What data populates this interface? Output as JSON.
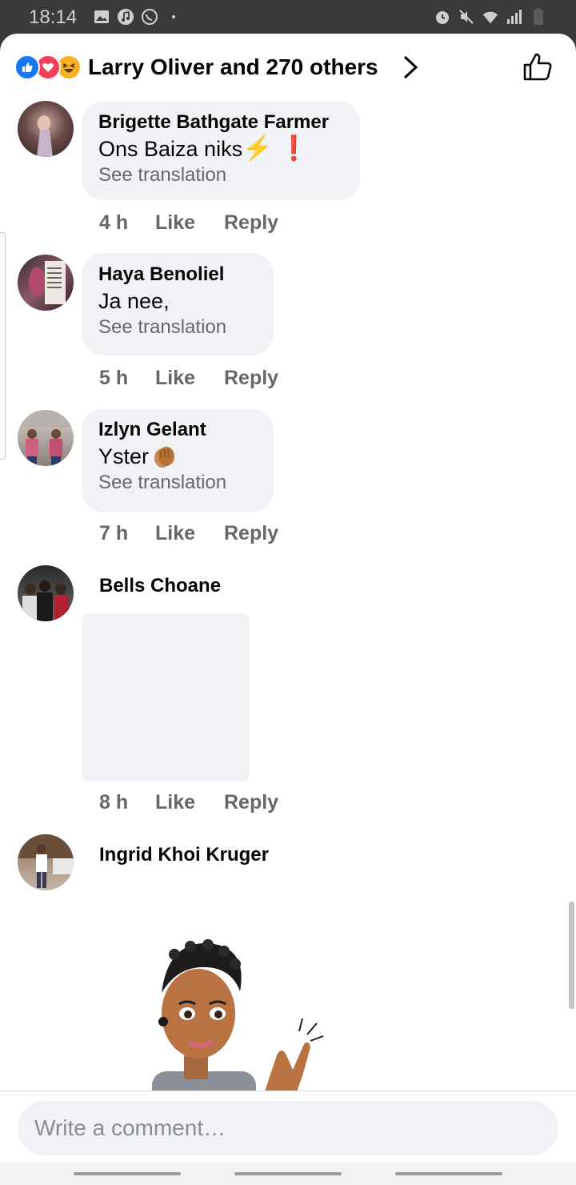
{
  "status_bar": {
    "time": "18:14",
    "left_icons": [
      "gallery-icon",
      "music-icon",
      "whatsapp-icon",
      "dot-icon"
    ],
    "right_icons": [
      "alarm-icon",
      "mute-icon",
      "wifi-icon",
      "signal-icon",
      "battery-icon"
    ]
  },
  "header": {
    "reactions": [
      "like",
      "love",
      "haha"
    ],
    "title": "Larry Oliver and 270 others"
  },
  "comments": [
    {
      "name": "Brigette Bathgate Farmer",
      "text": "Ons Baiza niks",
      "emojis": [
        "⚡",
        "❗"
      ],
      "translation": "See translation",
      "time": "4 h",
      "like": "Like",
      "reply": "Reply"
    },
    {
      "name": "Haya Benoliel",
      "text": "Ja nee,",
      "translation": "See translation",
      "time": "5 h",
      "like": "Like",
      "reply": "Reply"
    },
    {
      "name": "Izlyn Gelant",
      "text": "Yster",
      "emojis": [
        "clapping-hands"
      ],
      "translation": "See translation",
      "time": "7 h",
      "like": "Like",
      "reply": "Reply"
    },
    {
      "name": "Bells Choane",
      "time": "8 h",
      "like": "Like",
      "reply": "Reply"
    },
    {
      "name": "Ingrid Khoi Kruger"
    }
  ],
  "composer": {
    "placeholder": "Write a comment…"
  },
  "colors": {
    "like_blue": "#1877f2",
    "love_red": "#f33e58",
    "haha_yellow": "#f7b125",
    "bubble": "#f0f2f5",
    "secondary_text": "#65676b"
  }
}
